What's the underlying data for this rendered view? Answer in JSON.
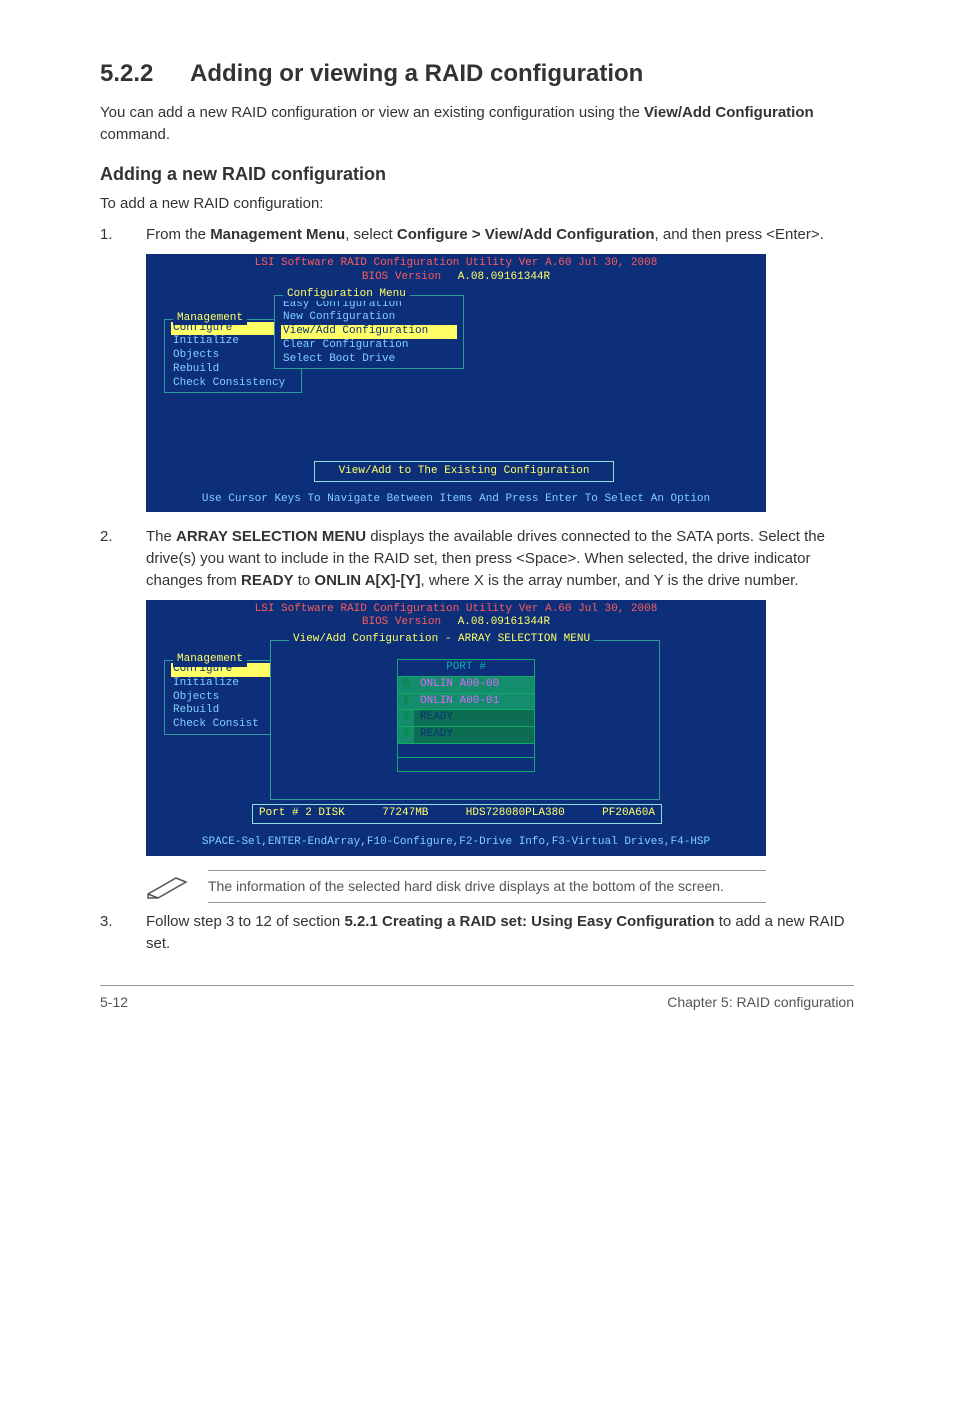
{
  "heading": {
    "number": "5.2.2",
    "title": "Adding or viewing a RAID configuration"
  },
  "intro": {
    "prefix": "You can add a new RAID configuration or view an existing configuration using the ",
    "bold": "View/Add Configuration",
    "suffix": " command."
  },
  "subheading": "Adding a new RAID configuration",
  "subintro": "To add a new RAID configuration:",
  "step1": {
    "num": "1.",
    "t1": "From the ",
    "b1": "Management Menu",
    "t2": ", select ",
    "b2": "Configure > View/Add Configuration",
    "t3": ", and then press <Enter>."
  },
  "bios1": {
    "title": "LSI Software RAID Configuration Utility Ver A.60 Jul 30, 2008",
    "version": "BIOS Version   A.08.09161344R",
    "menu_title": "Management",
    "menu_items": [
      "Configure",
      "Initialize",
      "Objects",
      "Rebuild",
      "Check Consistency"
    ],
    "conf_title": "Configuration Menu",
    "conf_items": [
      "Easy Configuration",
      "New Configuration",
      "View/Add Configuration",
      "Clear Configuration",
      "Select Boot Drive"
    ],
    "msg": "View/Add to The Existing Configuration",
    "footer": "Use Cursor Keys To Navigate Between Items And Press Enter To Select An Option"
  },
  "step2": {
    "num": "2.",
    "t1": "The ",
    "b1": "ARRAY SELECTION MENU",
    "t2": " displays the available drives connected to the SATA ports. Select the drive(s) you want to include in the RAID set, then press <Space>. When selected, the drive indicator changes from ",
    "b2": "READY",
    "t3": " to ",
    "b3": "ONLIN A[X]-[Y]",
    "t4": ", where X is the array number, and Y is the drive number."
  },
  "bios2": {
    "title": "LSI Software RAID Configuration Utility Ver A.60 Jul 30, 2008",
    "version": "BIOS Version   A.08.09161344R",
    "view_title": "View/Add Configuration - ARRAY SELECTION MENU",
    "menu_title": "Management",
    "menu_items": [
      "Configure",
      "Initialize",
      "Objects",
      "Rebuild",
      "Check Consist"
    ],
    "port_header": "PORT #",
    "ports": [
      {
        "idx": "0",
        "val": "ONLIN A00-00"
      },
      {
        "idx": "1",
        "val": "ONLIN A00-01"
      },
      {
        "idx": "2",
        "val": "READY"
      },
      {
        "idx": "3",
        "val": "READY"
      }
    ],
    "status": {
      "a": "Port # 2 DISK",
      "b": "77247MB",
      "c": "HDS728080PLA380",
      "d": "PF20A60A"
    },
    "footer": "SPACE-Sel,ENTER-EndArray,F10-Configure,F2-Drive Info,F3-Virtual Drives,F4-HSP"
  },
  "note": "The information of the selected hard disk drive displays at the bottom of the screen.",
  "step3": {
    "num": "3.",
    "t1": "Follow step 3 to 12 of section ",
    "b1": "5.2.1 Creating a RAID set: Using Easy Configuration",
    "t2": " to add a new RAID set."
  },
  "footer": {
    "page": "5-12",
    "chapter": "Chapter 5: RAID configuration"
  }
}
